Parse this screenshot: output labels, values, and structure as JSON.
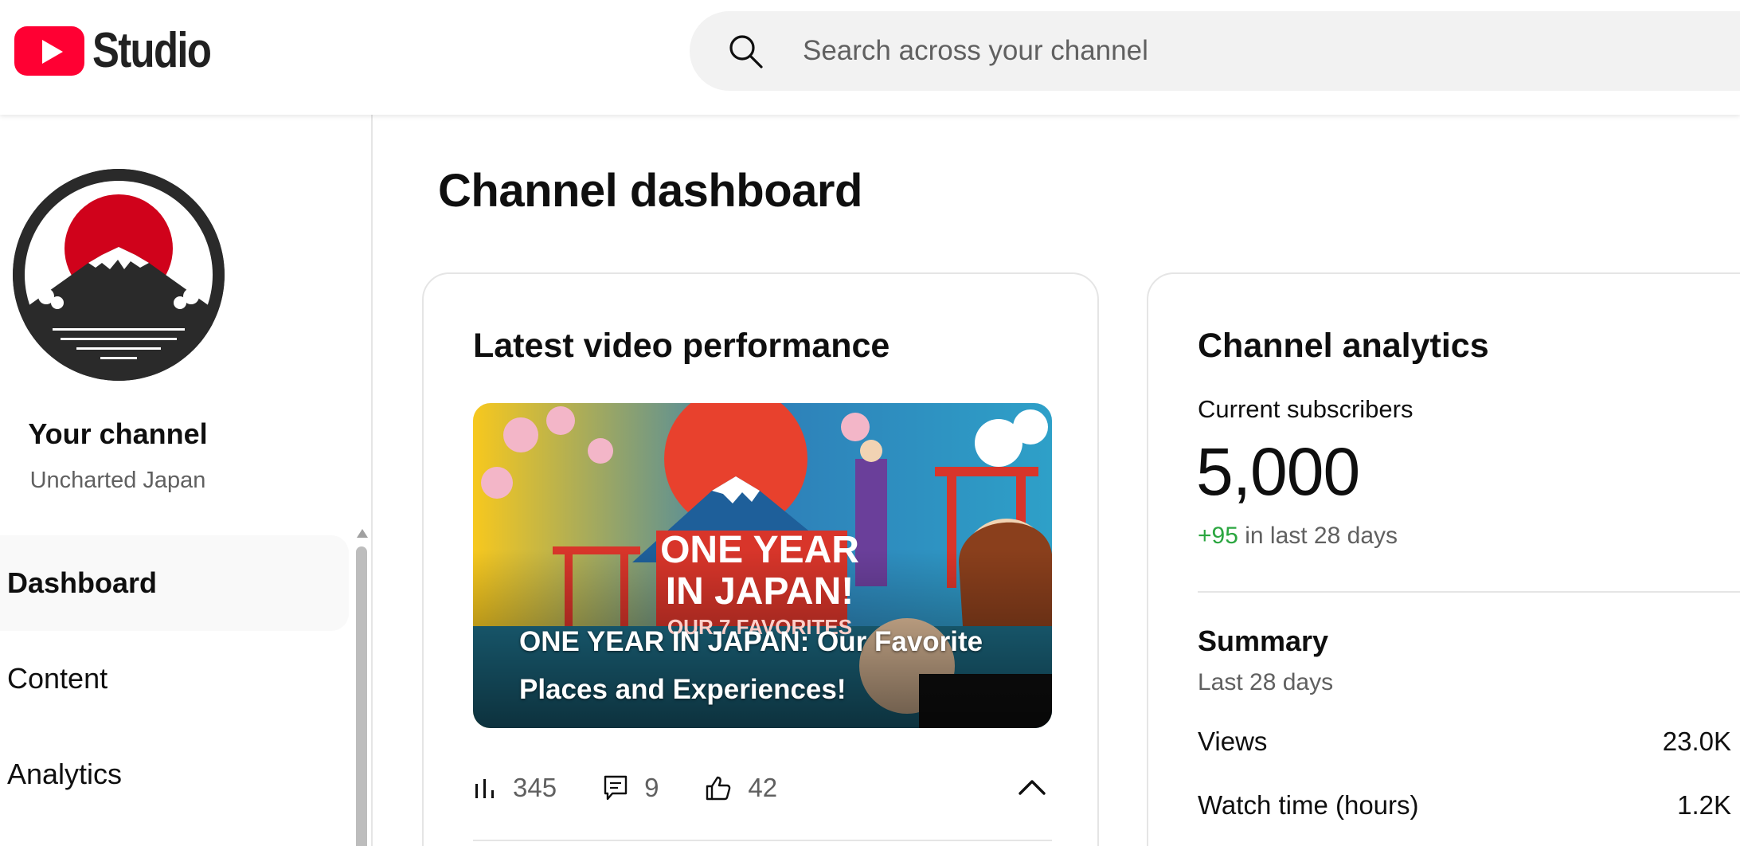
{
  "header": {
    "logo_text": "Studio",
    "search_placeholder": "Search across your channel"
  },
  "sidebar": {
    "channel_label": "Your channel",
    "channel_name": "Uncharted Japan",
    "items": [
      {
        "label": "Dashboard",
        "active": true
      },
      {
        "label": "Content",
        "active": false
      },
      {
        "label": "Analytics",
        "active": false
      }
    ]
  },
  "main": {
    "title": "Channel dashboard",
    "video_card": {
      "title": "Latest video performance",
      "thumbnail_text_line1": "ONE YEAR",
      "thumbnail_text_line2": "IN JAPAN!",
      "thumbnail_text_line3": "OUR 7 FAVORITES",
      "video_title": "ONE YEAR IN JAPAN: Our Favorite Places and Experiences!",
      "views": "345",
      "comments": "9",
      "likes": "42"
    },
    "analytics_card": {
      "title": "Channel analytics",
      "subscribers_label": "Current subscribers",
      "subscribers_count": "5,000",
      "subscribers_delta": "+95",
      "subscribers_delta_suffix": " in last 28 days",
      "summary_title": "Summary",
      "summary_period": "Last 28 days",
      "metrics": [
        {
          "label": "Views",
          "value": "23.0K"
        },
        {
          "label": "Watch time (hours)",
          "value": "1.2K"
        }
      ]
    }
  },
  "colors": {
    "brand_red": "#ff0033",
    "positive_green": "#2ba640",
    "secondary_text": "#606060"
  }
}
